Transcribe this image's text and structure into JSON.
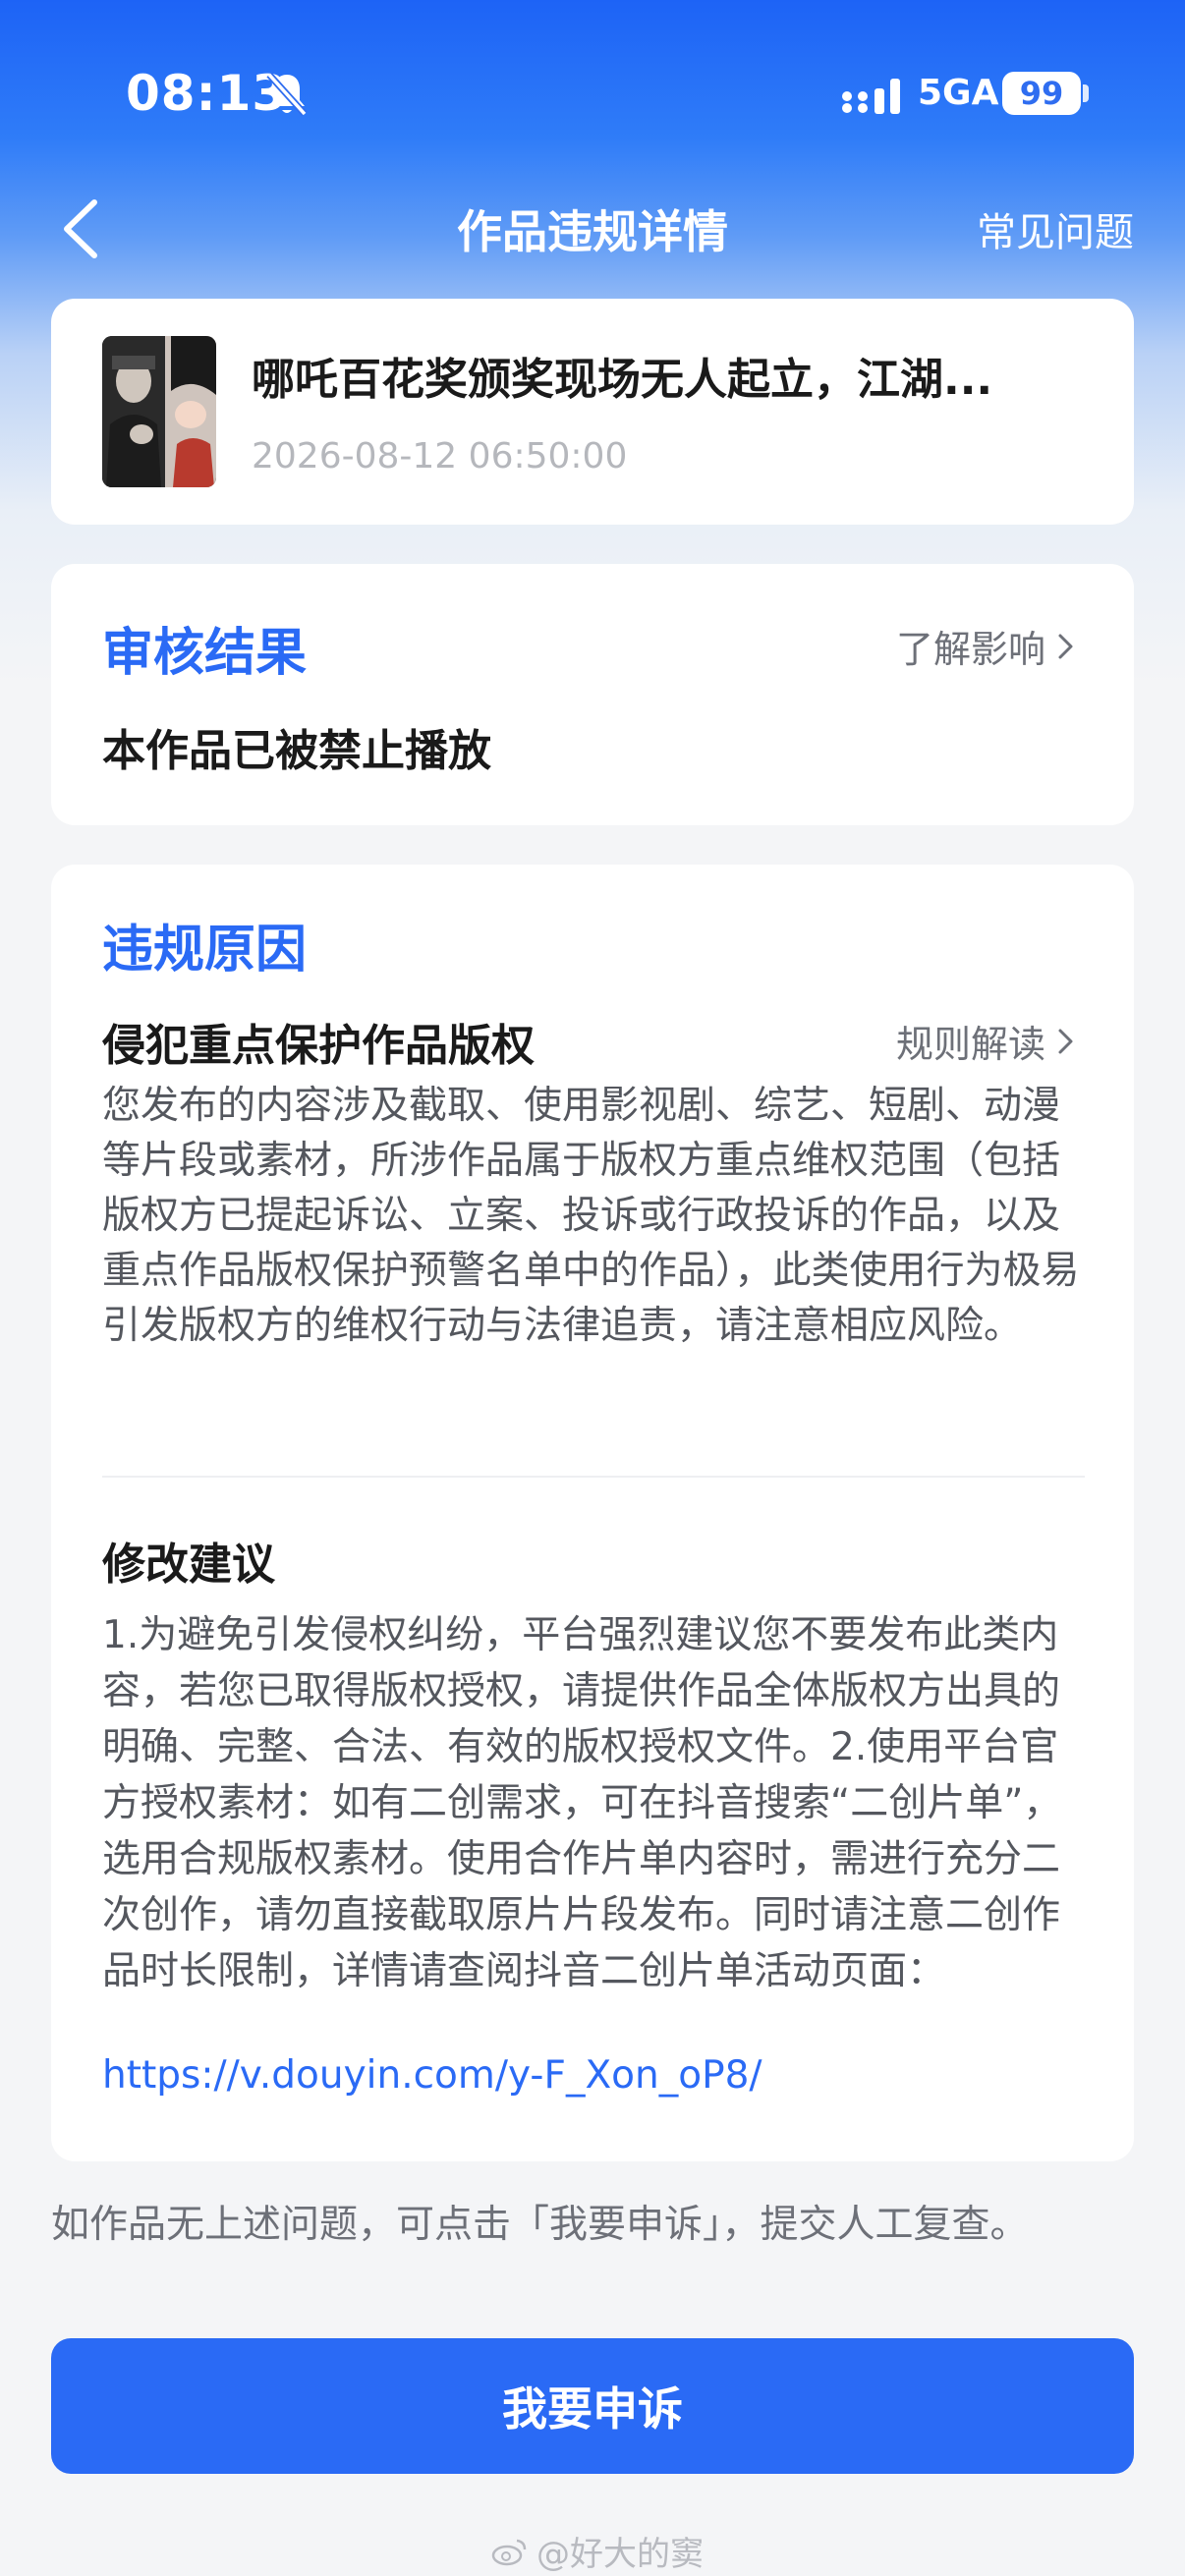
{
  "status_bar": {
    "time": "08:13",
    "network": "5GA",
    "battery": "99"
  },
  "nav": {
    "title": "作品违规详情",
    "faq": "常见问题"
  },
  "video": {
    "title": "哪吒百花奖颁奖现场无人起立，江湖...",
    "time": "2026-08-12 06:50:00"
  },
  "result": {
    "title": "审核结果",
    "link": "了解影响",
    "text": "本作品已被禁止播放"
  },
  "reason": {
    "title": "违规原因",
    "heading": "侵犯重点保护作品版权",
    "link": "规则解读",
    "body": "您发布的内容涉及截取、使用影视剧、综艺、短剧、动漫等片段或素材，所涉作品属于版权方重点维权范围（包括版权方已提起诉讼、立案、投诉或行政投诉的作品，以及重点作品版权保护预警名单中的作品），此类使用行为极易引发版权方的维权行动与法律追责，请注意相应风险。"
  },
  "suggestion": {
    "heading": "修改建议",
    "body": "1.为避免引发侵权纠纷，平台强烈建议您不要发布此类内容，若您已取得版权授权，请提供作品全体版权方出具的明确、完整、合法、有效的版权授权文件。2.使用平台官方授权素材：如有二创需求，可在抖音搜索“二创片单”，选用合规版权素材。使用合作片单内容时，需进行充分二次创作，请勿直接截取原片片段发布。同时请注意二创作品时长限制，详情请查阅抖音二创片单活动页面：",
    "link": "https://v.douyin.com/y-F_Xon_oP8/"
  },
  "appeal": {
    "hint": "如作品无上述问题，可点击「我要申诉」，提交人工复查。",
    "button": "我要申诉"
  },
  "watermark": "@好大的窦",
  "colors": {
    "accent": "#2a6af5",
    "header": "#1d63f6"
  }
}
